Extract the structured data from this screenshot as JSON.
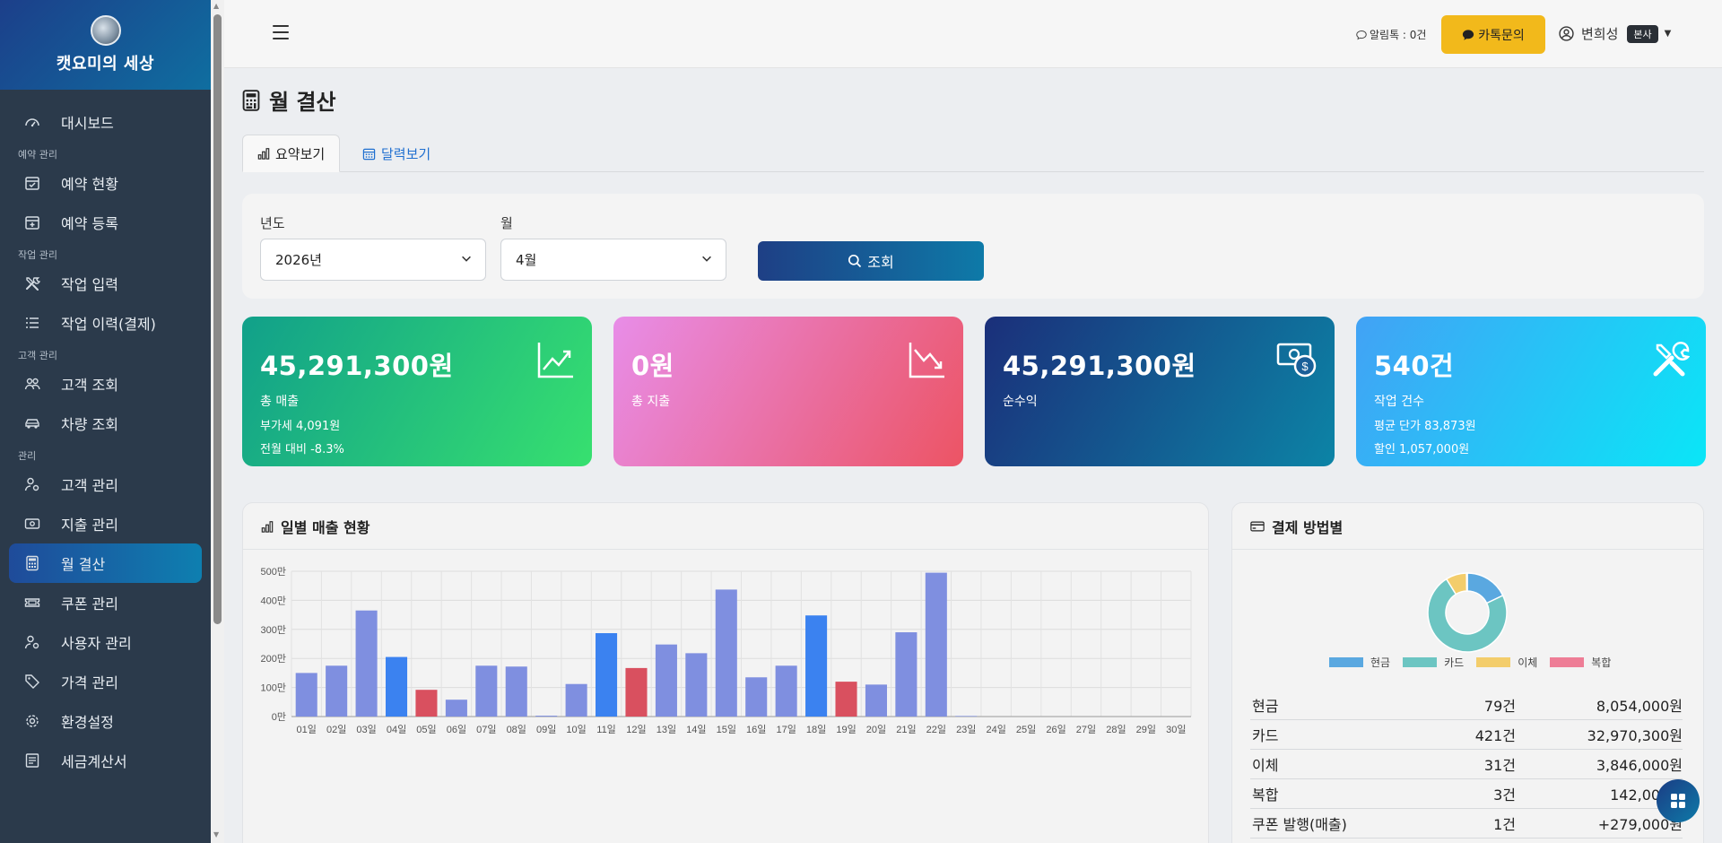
{
  "brand": {
    "title": "캣요미의 세상"
  },
  "sidebar": {
    "items": [
      {
        "type": "item",
        "label": "대시보드",
        "icon": "dashboard-icon"
      },
      {
        "type": "section",
        "label": "예약 관리"
      },
      {
        "type": "item",
        "label": "예약 현황",
        "icon": "calendar-check-icon"
      },
      {
        "type": "item",
        "label": "예약 등록",
        "icon": "calendar-plus-icon"
      },
      {
        "type": "section",
        "label": "작업 관리"
      },
      {
        "type": "item",
        "label": "작업 입력",
        "icon": "tools-icon"
      },
      {
        "type": "item",
        "label": "작업 이력(결제)",
        "icon": "list-icon"
      },
      {
        "type": "section",
        "label": "고객 관리"
      },
      {
        "type": "item",
        "label": "고객 조회",
        "icon": "people-icon"
      },
      {
        "type": "item",
        "label": "차량 조회",
        "icon": "car-icon"
      },
      {
        "type": "section",
        "label": "관리"
      },
      {
        "type": "item",
        "label": "고객 관리",
        "icon": "person-gear-icon"
      },
      {
        "type": "item",
        "label": "지출 관리",
        "icon": "cash-icon"
      },
      {
        "type": "item",
        "label": "월 결산",
        "icon": "calculator-icon",
        "active": true
      },
      {
        "type": "item",
        "label": "쿠폰 관리",
        "icon": "ticket-icon"
      },
      {
        "type": "item",
        "label": "사용자 관리",
        "icon": "person-gear-icon"
      },
      {
        "type": "item",
        "label": "가격 관리",
        "icon": "tag-icon"
      },
      {
        "type": "item",
        "label": "환경설정",
        "icon": "gear-icon"
      },
      {
        "type": "item",
        "label": "세금계산서",
        "icon": "receipt-icon"
      }
    ]
  },
  "topbar": {
    "alimtalk": "알림톡 : 0건",
    "kakao_button": "카톡문의",
    "user_name": "변희성",
    "user_badge": "본사"
  },
  "page": {
    "title": "월 결산",
    "tabs": [
      "요약보기",
      "달력보기"
    ]
  },
  "filter": {
    "year_label": "년도",
    "year_value": "2026년",
    "month_label": "월",
    "month_value": "4월",
    "search_label": "조회"
  },
  "cards": [
    {
      "value": "45,291,300원",
      "label": "총 매출",
      "lines": [
        "부가세 4,091원",
        "전월 대비 -8.3%"
      ],
      "icon": "trend-up-icon"
    },
    {
      "value": "0원",
      "label": "총 지출",
      "lines": [],
      "icon": "trend-down-icon"
    },
    {
      "value": "45,291,300원",
      "label": "순수익",
      "lines": [],
      "icon": "cash-coin-icon"
    },
    {
      "value": "540건",
      "label": "작업 건수",
      "lines": [
        "평균 단가 83,873원",
        "할인 1,057,000원"
      ],
      "icon": "tools-icon"
    }
  ],
  "daily_panel": {
    "title": "일별 매출 현황"
  },
  "payment_panel": {
    "title": "결제 방법별",
    "legend": [
      "현금",
      "카드",
      "이체",
      "복합"
    ],
    "rows": [
      {
        "name": "현금",
        "count": "79건",
        "amount": "8,054,000원"
      },
      {
        "name": "카드",
        "count": "421건",
        "amount": "32,970,300원"
      },
      {
        "name": "이체",
        "count": "31건",
        "amount": "3,846,000원"
      },
      {
        "name": "복합",
        "count": "3건",
        "amount": "142,000원"
      },
      {
        "name": "쿠폰 발행(매출)",
        "count": "1건",
        "amount": "+279,000원"
      }
    ]
  },
  "colors": {
    "bar_default": "#7f8fe0",
    "bar_blue": "#3b82f0",
    "bar_red": "#d9505f",
    "cash": "#5aa8e0",
    "card": "#6cc5c2",
    "transfer": "#f3cd6b",
    "mixed": "#ee7d96"
  },
  "chart_data": [
    {
      "type": "bar",
      "categories": [
        "01일",
        "02일",
        "03일",
        "04일",
        "05일",
        "06일",
        "07일",
        "08일",
        "09일",
        "10일",
        "11일",
        "12일",
        "13일",
        "14일",
        "15일",
        "16일",
        "17일",
        "18일",
        "19일",
        "20일",
        "21일",
        "22일",
        "23일",
        "24일",
        "25일",
        "26일",
        "27일",
        "28일",
        "29일",
        "30일"
      ],
      "values": [
        150,
        175,
        365,
        205,
        92,
        58,
        175,
        172,
        3,
        112,
        287,
        167,
        248,
        218,
        437,
        135,
        175,
        348,
        120,
        110,
        290,
        495,
        2,
        0,
        0,
        0,
        0,
        0,
        0,
        0
      ],
      "bar_colors": [
        "default",
        "default",
        "default",
        "blue",
        "red",
        "default",
        "default",
        "default",
        "default",
        "default",
        "blue",
        "red",
        "default",
        "default",
        "default",
        "default",
        "default",
        "blue",
        "red",
        "default",
        "default",
        "default",
        "default",
        "default",
        "default",
        "default",
        "default",
        "default",
        "default",
        "default"
      ],
      "y_ticks": [
        "0만",
        "100만",
        "200만",
        "300만",
        "400만",
        "500만"
      ],
      "ylim": [
        0,
        500
      ],
      "grid": true
    },
    {
      "type": "pie",
      "labels": [
        "현금",
        "카드",
        "이체",
        "복합"
      ],
      "values": [
        8054000,
        32970300,
        3846000,
        142000
      ]
    }
  ]
}
